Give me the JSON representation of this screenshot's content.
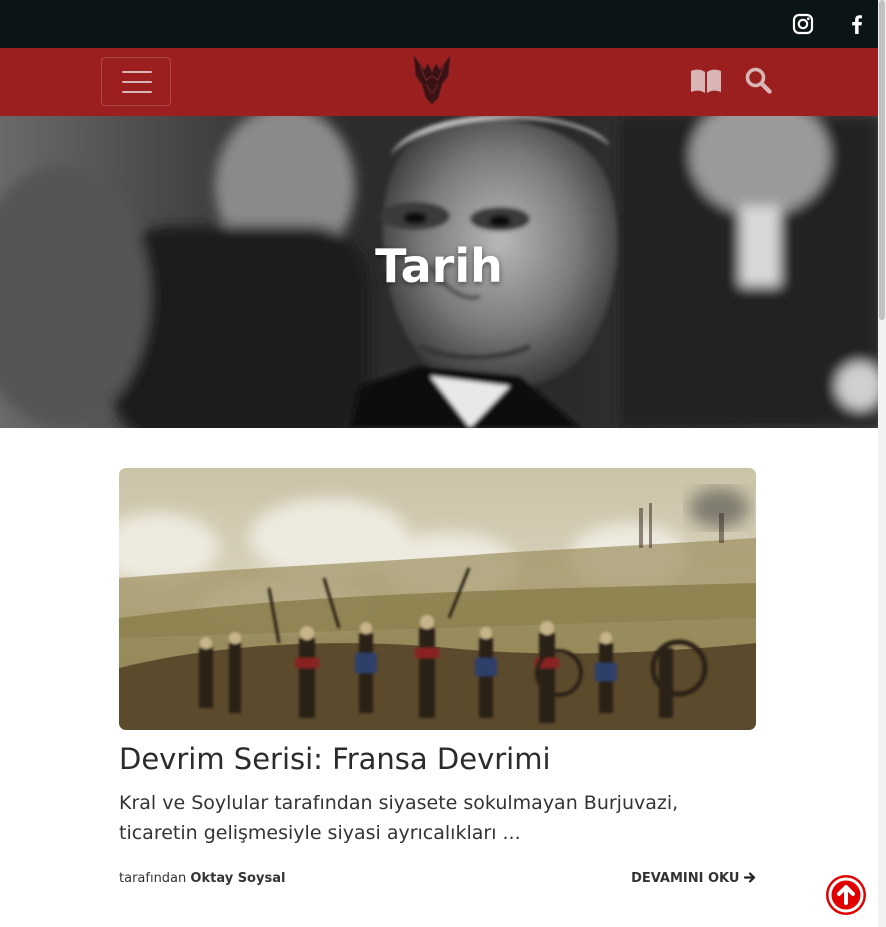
{
  "topbar": {
    "social": [
      {
        "icon": "instagram-icon"
      },
      {
        "icon": "facebook-icon"
      }
    ]
  },
  "navbar": {
    "menu_icon": "hamburger-icon",
    "logo_icon": "wolf-head-logo",
    "book_icon": "open-book-icon",
    "search_icon": "search-icon",
    "colors": {
      "background": "#9b1f1f",
      "icons": "#d9b6b6"
    }
  },
  "hero": {
    "title": "Tarih"
  },
  "post": {
    "title": "Devrim Serisi: Fransa Devrimi",
    "excerpt": "Kral ve Soylular tarafından siyasete sokulmayan Burjuvazi, ticaretin gelişmesiyle siyasi ayrıcalıkları ...",
    "by_label": "tarafından",
    "author": "Oktay Soysal",
    "read_more": "DEVAMINI OKU",
    "read_more_icon": "arrow-right-icon"
  },
  "scroll_top": {
    "icon": "arrow-up-circle-icon",
    "color": "#e00000"
  }
}
